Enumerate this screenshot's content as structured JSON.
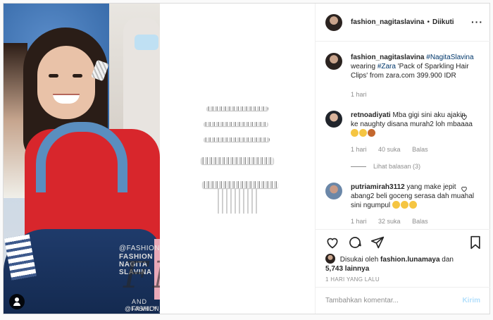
{
  "header": {
    "username": "fashion_nagitaslavina",
    "separator": "•",
    "follow_status": "Diikuti",
    "more_label": "···"
  },
  "caption": {
    "username": "fashion_nagitaslavina",
    "hashtag": "#NagitaSlavina",
    "text_1": "wearing",
    "brand_tag": "#Zara",
    "text_2": "'Pack of Sparkling Hair Clips' from zara.com 399.900 IDR",
    "time": "1 hari"
  },
  "comments": [
    {
      "username": "retnoadiyati",
      "text": "Mba gigi sini aku ajakin ke naughty disana murah2 loh mbaaaa",
      "time": "1 hari",
      "likes": "40 suka",
      "reply": "Balas",
      "view_replies": "Lihat balasan (3)"
    },
    {
      "username": "putriamirah3112",
      "text": "yang make jepit abang2 beli goceng serasa dah muahal sini ngumpul",
      "time": "1 hari",
      "likes": "32 suka",
      "reply": "Balas"
    }
  ],
  "likes": {
    "prefix": "Disukai oleh",
    "user": "fashion.lunamaya",
    "conj": "dan",
    "count": "5,743 lainnya"
  },
  "post_time": "1 HARI YANG LALU",
  "add_comment": {
    "placeholder": "Tambahkan komentar...",
    "send": "Kirim"
  },
  "watermark": {
    "top": "@FASHION_NAGITASLAVINA",
    "name": "FASHION NAGITA SLAVINA",
    "logo": "FNS",
    "family": "AND FAMILY",
    "handle": "@FASHION_NAGITASLAVINA"
  },
  "colors": {
    "link": "#00376b",
    "muted": "#8e8e8e",
    "send_disabled": "#b2dffc"
  }
}
